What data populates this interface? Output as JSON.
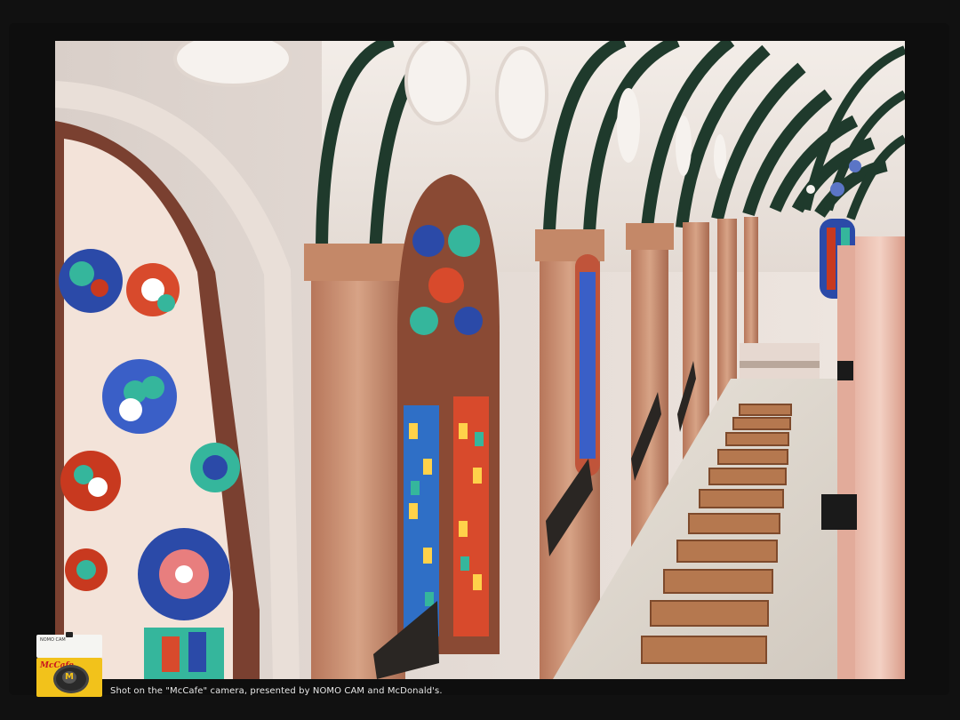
{
  "caption": "Shot on the \"McCafe\" camera, presented by NOMO CAM and McDonald's.",
  "camera_badge": {
    "top_label": "NOMO CAM",
    "body_label": "McCafe",
    "lens_glyph": "M",
    "body_color": "#f2c21b"
  },
  "photo": {
    "subject": "church-interior",
    "frame_color": "#0e0e0e"
  }
}
